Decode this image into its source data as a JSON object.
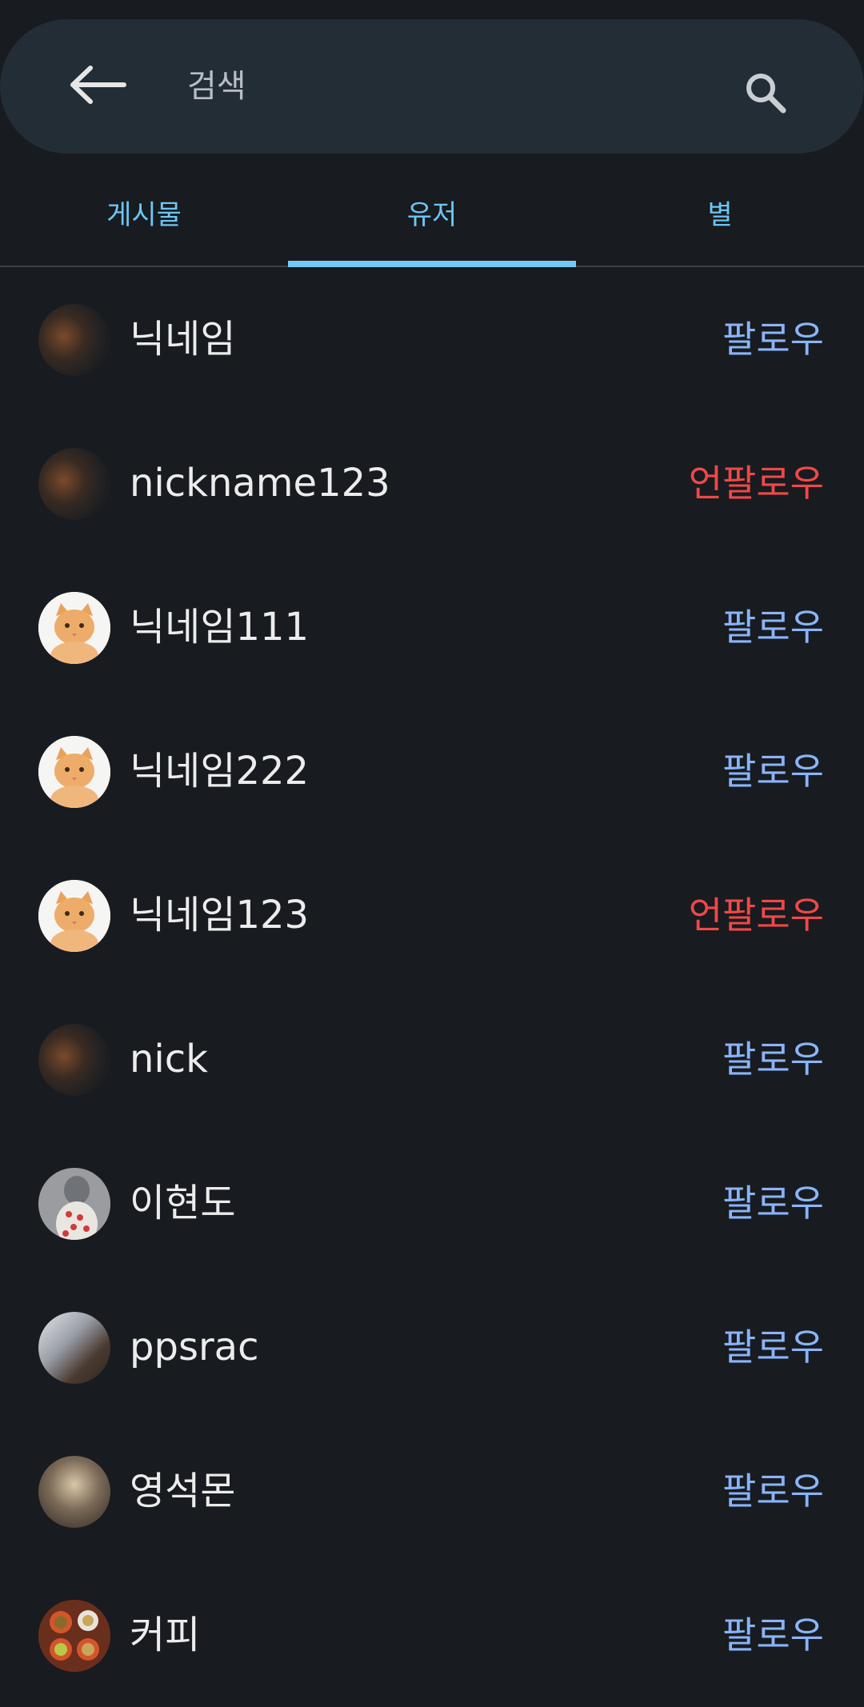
{
  "search": {
    "placeholder": "검색"
  },
  "tabs": [
    {
      "label": "게시물"
    },
    {
      "label": "유저"
    },
    {
      "label": "별"
    }
  ],
  "active_tab": "유저",
  "colors": {
    "background": "#181b1f",
    "search_bar": "#232d36",
    "tab_text": "#6cc6f5",
    "tab_indicator": "#74c8f6",
    "follow": "#8ab4f8",
    "unfollow": "#f04848"
  },
  "users": [
    {
      "nickname": "닉네임",
      "action": "팔로우",
      "avatar": "dark"
    },
    {
      "nickname": "nickname123",
      "action": "언팔로우",
      "avatar": "dark"
    },
    {
      "nickname": "닉네임111",
      "action": "팔로우",
      "avatar": "cat"
    },
    {
      "nickname": "닉네임222",
      "action": "팔로우",
      "avatar": "cat"
    },
    {
      "nickname": "닉네임123",
      "action": "언팔로우",
      "avatar": "cat"
    },
    {
      "nickname": "nick",
      "action": "팔로우",
      "avatar": "dark"
    },
    {
      "nickname": "이현도",
      "action": "팔로우",
      "avatar": "art"
    },
    {
      "nickname": "ppsrac",
      "action": "팔로우",
      "avatar": "dogs"
    },
    {
      "nickname": "영석몬",
      "action": "팔로우",
      "avatar": "person"
    },
    {
      "nickname": "커피",
      "action": "팔로우",
      "avatar": "coffee"
    }
  ]
}
